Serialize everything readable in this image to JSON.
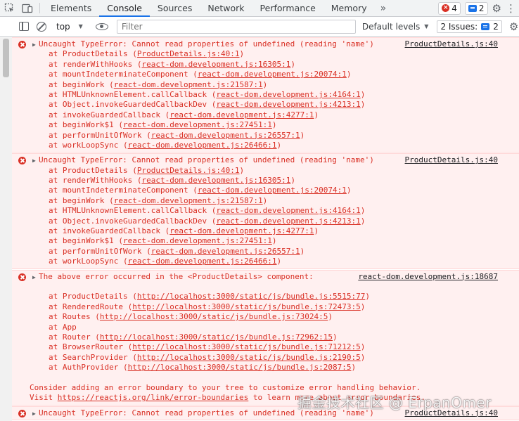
{
  "tabbar": {
    "tabs": [
      {
        "label": "Elements"
      },
      {
        "label": "Console"
      },
      {
        "label": "Sources"
      },
      {
        "label": "Network"
      },
      {
        "label": "Performance"
      },
      {
        "label": "Memory"
      }
    ],
    "more": "»",
    "error_count": "4",
    "message_count": "2"
  },
  "toolbar": {
    "context": "top",
    "filter_placeholder": "Filter",
    "levels": "Default levels",
    "issues_label": "2 Issues:",
    "issues_count": "2"
  },
  "console": {
    "entries": [
      {
        "head": "Uncaught TypeError: Cannot read properties of undefined (reading 'name')",
        "source": "ProductDetails.js:40",
        "stack": [
          {
            "fn": "at ProductDetails (",
            "loc": "ProductDetails.js:40:1",
            "end": ")"
          },
          {
            "fn": "at renderWithHooks (",
            "loc": "react-dom.development.js:16305:1",
            "end": ")"
          },
          {
            "fn": "at mountIndeterminateComponent (",
            "loc": "react-dom.development.js:20074:1",
            "end": ")"
          },
          {
            "fn": "at beginWork (",
            "loc": "react-dom.development.js:21587:1",
            "end": ")"
          },
          {
            "fn": "at HTMLUnknownElement.callCallback (",
            "loc": "react-dom.development.js:4164:1",
            "end": ")"
          },
          {
            "fn": "at Object.invokeGuardedCallbackDev (",
            "loc": "react-dom.development.js:4213:1",
            "end": ")"
          },
          {
            "fn": "at invokeGuardedCallback (",
            "loc": "react-dom.development.js:4277:1",
            "end": ")"
          },
          {
            "fn": "at beginWork$1 (",
            "loc": "react-dom.development.js:27451:1",
            "end": ")"
          },
          {
            "fn": "at performUnitOfWork (",
            "loc": "react-dom.development.js:26557:1",
            "end": ")"
          },
          {
            "fn": "at workLoopSync (",
            "loc": "react-dom.development.js:26466:1",
            "end": ")"
          }
        ]
      },
      {
        "head": "Uncaught TypeError: Cannot read properties of undefined (reading 'name')",
        "source": "ProductDetails.js:40",
        "stack": [
          {
            "fn": "at ProductDetails (",
            "loc": "ProductDetails.js:40:1",
            "end": ")"
          },
          {
            "fn": "at renderWithHooks (",
            "loc": "react-dom.development.js:16305:1",
            "end": ")"
          },
          {
            "fn": "at mountIndeterminateComponent (",
            "loc": "react-dom.development.js:20074:1",
            "end": ")"
          },
          {
            "fn": "at beginWork (",
            "loc": "react-dom.development.js:21587:1",
            "end": ")"
          },
          {
            "fn": "at HTMLUnknownElement.callCallback (",
            "loc": "react-dom.development.js:4164:1",
            "end": ")"
          },
          {
            "fn": "at Object.invokeGuardedCallbackDev (",
            "loc": "react-dom.development.js:4213:1",
            "end": ")"
          },
          {
            "fn": "at invokeGuardedCallback (",
            "loc": "react-dom.development.js:4277:1",
            "end": ")"
          },
          {
            "fn": "at beginWork$1 (",
            "loc": "react-dom.development.js:27451:1",
            "end": ")"
          },
          {
            "fn": "at performUnitOfWork (",
            "loc": "react-dom.development.js:26557:1",
            "end": ")"
          },
          {
            "fn": "at workLoopSync (",
            "loc": "react-dom.development.js:26466:1",
            "end": ")"
          }
        ]
      },
      {
        "head": "The above error occurred in the <ProductDetails> component:",
        "source": "react-dom.development.js:18687",
        "stack": [
          {
            "fn": "at ProductDetails (",
            "loc": "http://localhost:3000/static/js/bundle.js:5515:77",
            "end": ")"
          },
          {
            "fn": "at RenderedRoute (",
            "loc": "http://localhost:3000/static/js/bundle.js:72473:5",
            "end": ")"
          },
          {
            "fn": "at Routes (",
            "loc": "http://localhost:3000/static/js/bundle.js:73024:5",
            "end": ")"
          },
          {
            "fn": "at App",
            "loc": "",
            "end": ""
          },
          {
            "fn": "at Router (",
            "loc": "http://localhost:3000/static/js/bundle.js:72962:15",
            "end": ")"
          },
          {
            "fn": "at BrowserRouter (",
            "loc": "http://localhost:3000/static/js/bundle.js:71212:5",
            "end": ")"
          },
          {
            "fn": "at SearchProvider (",
            "loc": "http://localhost:3000/static/js/bundle.js:2190:5",
            "end": ")"
          },
          {
            "fn": "at AuthProvider (",
            "loc": "http://localhost:3000/static/js/bundle.js:2087:5",
            "end": ")"
          }
        ],
        "note1": "Consider adding an error boundary to your tree to customize error handling behavior.",
        "note2_prefix": "Visit ",
        "note2_link": "https://reactjs.org/link/error-boundaries",
        "note2_suffix": " to learn more about error boundaries."
      },
      {
        "head": "Uncaught TypeError: Cannot read properties of undefined (reading 'name')",
        "source": "ProductDetails.js:40"
      }
    ]
  },
  "watermark": "掘金技术社区 @ ErpanOmer",
  "colors": {
    "error": "#d93025",
    "error_bg": "#fff0f0",
    "accent": "#1a73e8"
  },
  "icons": [
    "inspect-icon",
    "device-toolbar-icon",
    "more-tabs-icon",
    "error-icon",
    "message-icon",
    "gear-icon",
    "kebab-menu-icon",
    "sidebar-toggle-icon",
    "clear-console-icon",
    "eye-icon",
    "caret-down-icon",
    "expand-triangle-icon"
  ]
}
